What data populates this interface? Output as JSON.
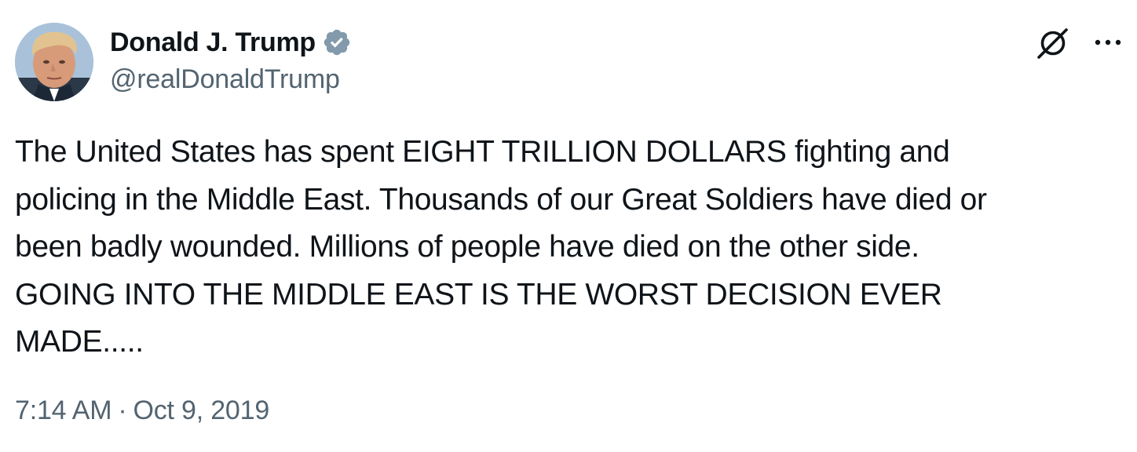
{
  "author": {
    "name": "Donald J. Trump",
    "handle": "@realDonaldTrump",
    "verified_icon": "verified-badge-icon",
    "verified_color": "#829aab",
    "avatar_icon": "avatar"
  },
  "actions": {
    "grok_icon": "grok-icon",
    "more_icon": "more-icon"
  },
  "tweet": {
    "text": "The United States has spent EIGHT TRILLION DOLLARS fighting and\npolicing in the Middle East. Thousands of our Great Soldiers have died or\nbeen badly wounded. Millions of people have died on the other side.\nGOING INTO THE MIDDLE EAST IS THE WORST DECISION EVER\nMADE....."
  },
  "meta": {
    "time": "7:14 AM",
    "separator": "·",
    "date": "Oct 9, 2019"
  },
  "colors": {
    "text": "#0f1419",
    "secondary": "#536471"
  }
}
